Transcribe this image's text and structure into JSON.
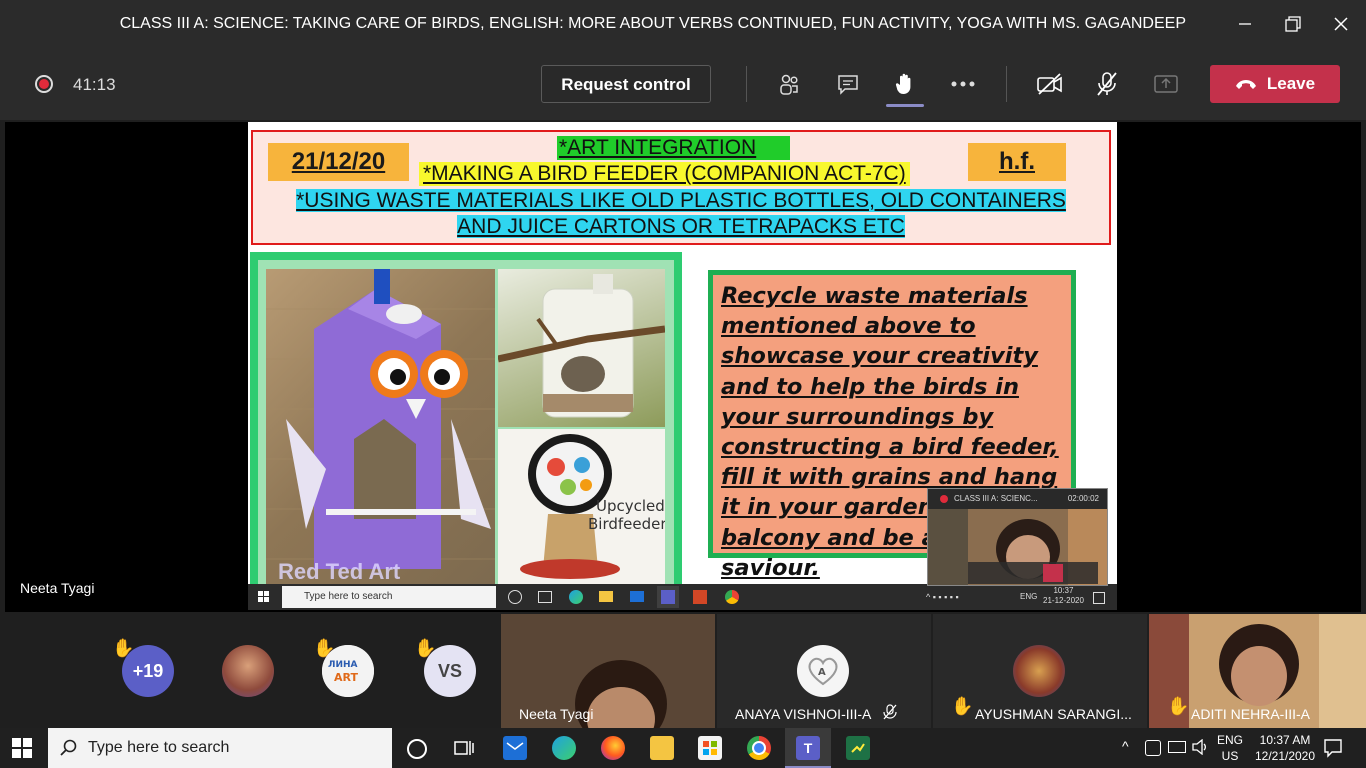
{
  "window": {
    "title": "CLASS III A: SCIENCE: TAKING CARE OF BIRDS, ENGLISH: MORE ABOUT VERBS CONTINUED, FUN ACTIVITY, YOGA WITH MS. GAGANDEEP"
  },
  "meeting": {
    "timer": "41:13",
    "request_control": "Request control",
    "leave": "Leave"
  },
  "slide": {
    "date": "21/12/20",
    "hf": "h.f.",
    "art_line": "*ART  INTEGRATION",
    "feeder_line": "*MAKING A BIRD FEEDER   (COMPANION ACT-7C)",
    "waste_line_1": "*USING WASTE MATERIALS LIKE OLD PLASTIC BOTTLES, OLD CONTAINERS",
    "waste_line_2": "AND JUICE CARTONS OR TETRAPACKS ETC",
    "photo_caption": "Upcycled Birdfeeder",
    "photo_watermark": "Red Ted Art",
    "recycle_text": " Recycle waste materials mentioned above to showcase your creativity and to help the birds in your surroundings by constructing a bird feeder, fill it with grains and hang it in your garden or balcony and be a bird saviour.",
    "inner_search": "Type here to search",
    "inner_lang": "ENG",
    "inner_time": "10:37",
    "inner_date": "21-12-2020",
    "pip_title": "CLASS III A: SCIENC...",
    "pip_timer": "02:00:02"
  },
  "stage": {
    "presenter_name": "Neeta Tyagi"
  },
  "participants": {
    "overflow_count": "+19",
    "vs_initials": "VS",
    "tiles": [
      {
        "name": "Neeta Tyagi"
      },
      {
        "name": "ANAYA VISHNOI-III-A"
      },
      {
        "name": "AYUSHMAN SARANGI..."
      },
      {
        "name": "ADITI NEHRA-III-A"
      }
    ]
  },
  "taskbar": {
    "search_placeholder": "Type here to search",
    "lang_top": "ENG",
    "lang_bottom": "US",
    "time": "10:37 AM",
    "date": "12/21/2020"
  },
  "colors": {
    "leave": "#c4314b",
    "raise_hand": "#ffb900",
    "slide_border": "#e01b1b"
  }
}
